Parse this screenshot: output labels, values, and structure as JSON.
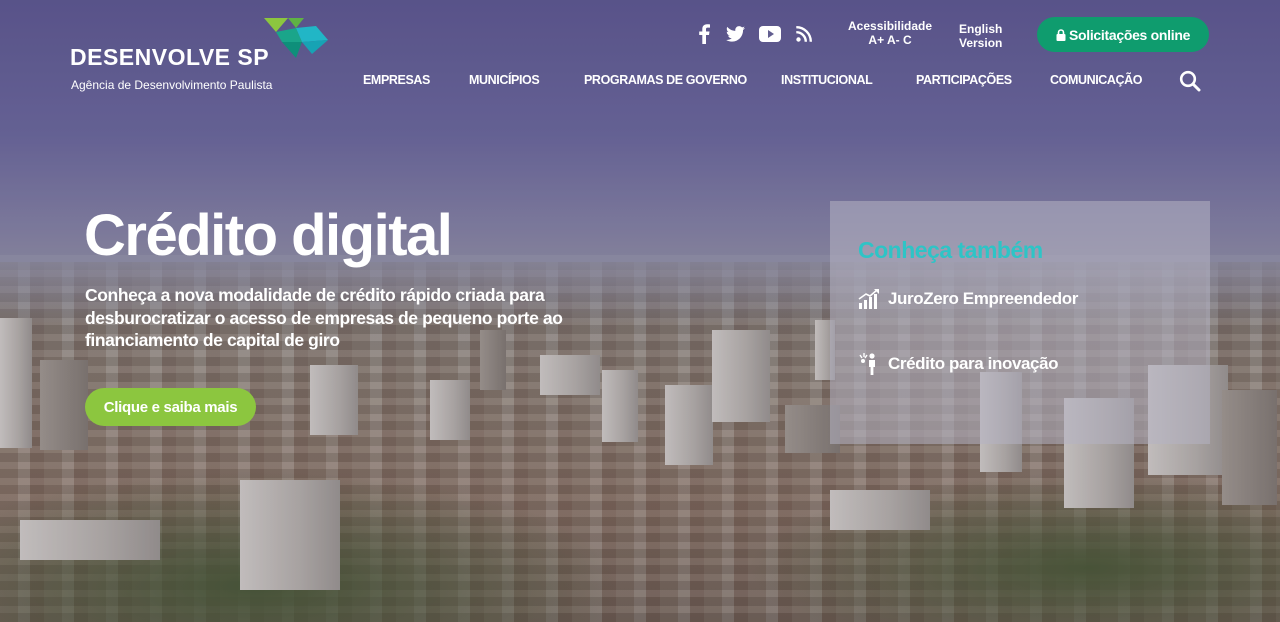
{
  "brand": {
    "name": "DESENVOLVE SP",
    "subtitle": "Agência de Desenvolvimento Paulista",
    "colors": {
      "green": "#8cc63f",
      "teal": "#2ec4c6",
      "dark_green": "#0f9c6e"
    }
  },
  "header": {
    "social_icons": [
      "facebook-icon",
      "twitter-icon",
      "youtube-icon",
      "rss-icon"
    ],
    "accessibility": {
      "label": "Acessibilidade",
      "controls": "A+ A- C"
    },
    "language": {
      "line1": "English",
      "line2": "Version"
    },
    "online_button": "Solicitações online"
  },
  "nav": {
    "items": [
      "EMPRESAS",
      "MUNICÍPIOS",
      "PROGRAMAS DE GOVERNO",
      "INSTITUCIONAL",
      "PARTICIPAÇÕES",
      "COMUNICAÇÃO"
    ]
  },
  "hero": {
    "title": "Crédito digital",
    "description": "Conheça a nova modalidade de crédito rápido criada para desburocratizar o acesso de empresas de pequeno porte ao financiamento de capital de giro",
    "cta": "Clique e saiba mais"
  },
  "panel": {
    "title": "Conheça também",
    "items": [
      {
        "label": "JuroZero Empreendedor",
        "icon": "growth-chart-icon"
      },
      {
        "label": "Crédito para inovação",
        "icon": "innovation-person-icon"
      }
    ]
  }
}
